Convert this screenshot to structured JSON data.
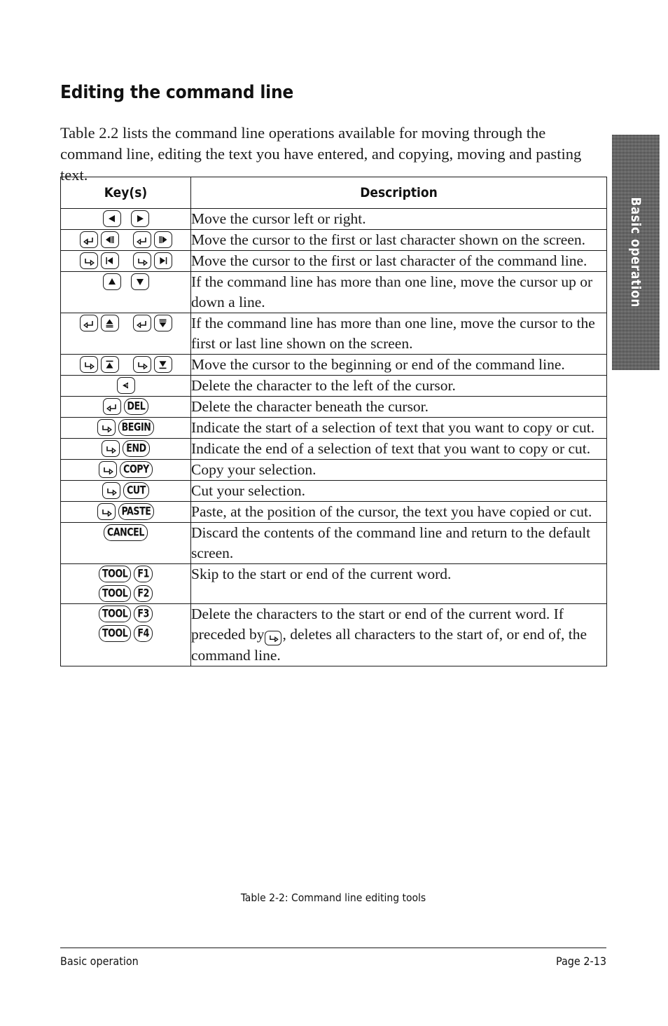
{
  "page": {
    "title": "Editing the command line",
    "intro": "Table 2.2 lists the command line operations available for moving through the command line, editing the text you have entered, and copying, moving and pasting text.",
    "side_tab_label": "Basic operation",
    "caption": "Table 2-2: Command line editing tools",
    "footer_left": "Basic operation",
    "footer_right": "Page 2-13"
  },
  "table": {
    "headers": {
      "keys": "Key(s)",
      "description": "Description"
    },
    "rows": [
      {
        "keys": "left-arrow-key right-arrow-key",
        "description": "Move the cursor left or right."
      },
      {
        "keys": "shift-left-key left-arrow-bars-key shift-left-key right-arrow-bars-key",
        "description": "Move the cursor to the first or last character shown on the screen."
      },
      {
        "keys": "shift-right-key left-arrow-bar-key shift-right-key right-arrow-bar-key",
        "description": "Move the cursor to the first or last character of the command line."
      },
      {
        "keys": "up-arrow-key down-arrow-key",
        "description": "If the command line has more than one line, move the cursor up or down a line."
      },
      {
        "keys": "shift-left-key up-arrow-bars-key shift-left-key down-arrow-bars-key",
        "description": "If the command line has more than one line, move the cursor to the first or last line shown on the screen."
      },
      {
        "keys": "shift-right-key up-arrow-bar-key shift-right-key down-arrow-bar-key",
        "description": "Move the cursor to the beginning or end of the command line."
      },
      {
        "keys": "backspace-key",
        "description": "Delete the character to the left of the cursor."
      },
      {
        "keys": "shift-left-key DEL",
        "description": "Delete the character beneath the cursor."
      },
      {
        "keys": "shift-right-key BEGIN",
        "description": "Indicate the start of a selection of text that you want to copy or cut."
      },
      {
        "keys": "shift-right-key END",
        "description": "Indicate the end of a selection of text that you want to copy or cut."
      },
      {
        "keys": "shift-right-key COPY",
        "description": "Copy your selection."
      },
      {
        "keys": "shift-right-key CUT",
        "description": "Cut your selection."
      },
      {
        "keys": "shift-right-key PASTE",
        "description": "Paste, at the position of the cursor, the text you have copied or cut."
      },
      {
        "keys": "CANCEL",
        "description": "Discard the contents of the command line and return to the default screen."
      },
      {
        "keys": "TOOL F1 / TOOL F2",
        "description": "Skip to the start or end of the current word."
      },
      {
        "keys": "TOOL F3 / TOOL F4",
        "description_part1": "Delete the characters to the start or end of the current",
        "description_part2": "word. If preceded by",
        "description_part3": ", deletes all characters to the start of, or end of, the command line."
      }
    ]
  },
  "key_labels": {
    "del": "DEL",
    "begin": "BEGIN",
    "end": "END",
    "copy": "COPY",
    "cut": "CUT",
    "paste": "PASTE",
    "cancel": "CANCEL",
    "tool": "TOOL",
    "f1": "F1",
    "f2": "F2",
    "f3": "F3",
    "f4": "F4"
  },
  "colors": {
    "ink": "#1a1a1a",
    "paper": "#ffffff",
    "tab_gray": "#8d8d8d",
    "tab_text": "#ffffff"
  }
}
